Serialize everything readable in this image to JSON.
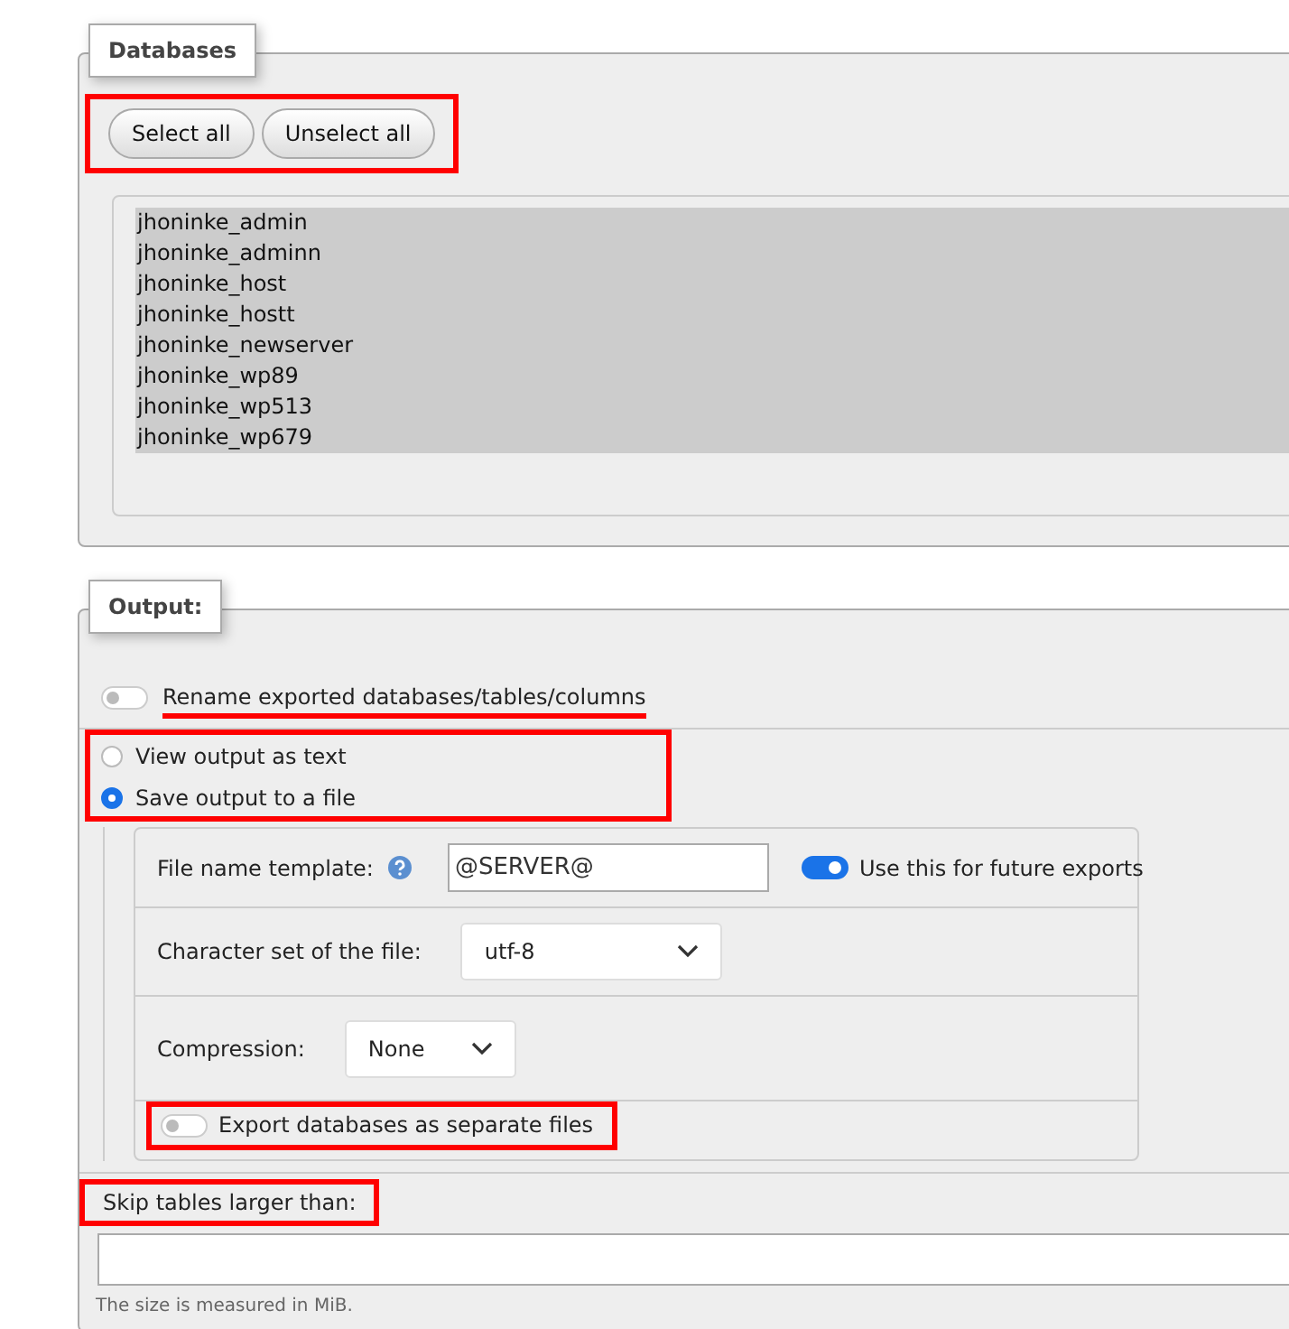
{
  "databases": {
    "legend": "Databases",
    "buttons": [
      "Select all",
      "Unselect all"
    ],
    "options": [
      {
        "label": "jhoninke_admin",
        "selected": true
      },
      {
        "label": "jhoninke_adminn",
        "selected": true
      },
      {
        "label": "jhoninke_host",
        "selected": true
      },
      {
        "label": "jhoninke_hostt",
        "selected": true
      },
      {
        "label": "jhoninke_newserver",
        "selected": true
      },
      {
        "label": "jhoninke_wp89",
        "selected": true
      },
      {
        "label": "jhoninke_wp513",
        "selected": true
      },
      {
        "label": "jhoninke_wp679",
        "selected": true
      }
    ]
  },
  "output": {
    "legend": "Output:",
    "rename": {
      "label": "Rename exported databases/tables/columns",
      "on": false
    },
    "modes": [
      {
        "label": "View output as text",
        "selected": false
      },
      {
        "label": "Save output to a file",
        "selected": true
      }
    ],
    "file_name_template": {
      "label": "File name template:",
      "value": "@SERVER@",
      "future": {
        "label": "Use this for future exports",
        "on": true
      }
    },
    "charset": {
      "label": "Character set of the file:",
      "value": "utf-8"
    },
    "compression": {
      "label": "Compression:",
      "value": "None"
    },
    "separate": {
      "label": "Export databases as separate files",
      "on": false
    },
    "skip": {
      "label": "Skip tables larger than:",
      "hint": "The size is measured in MiB."
    }
  }
}
